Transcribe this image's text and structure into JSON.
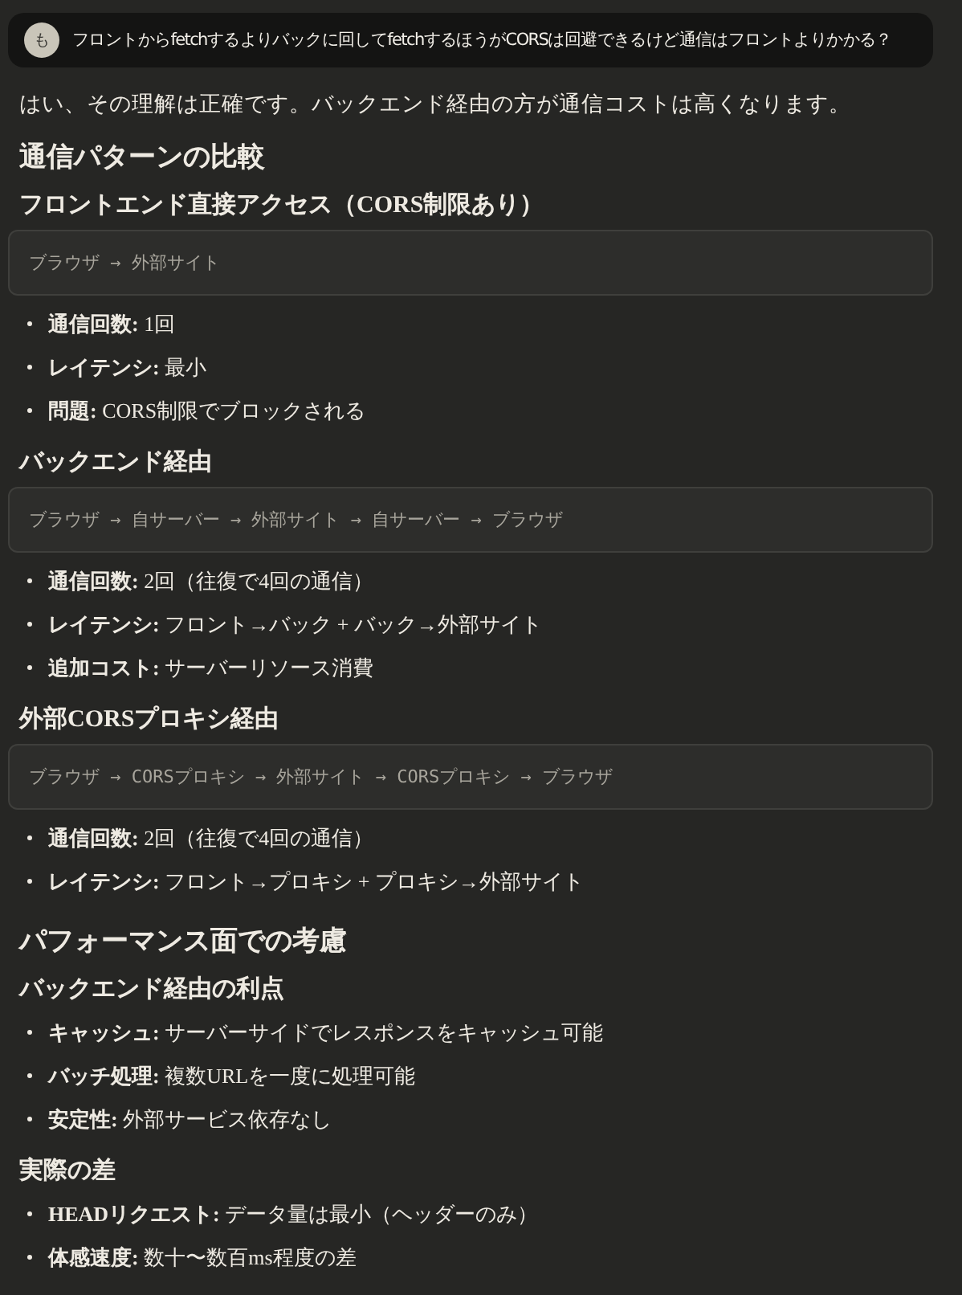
{
  "user_message": {
    "avatar": "も",
    "text": "フロントからfetchするよりバックに回してfetchするほうがCORSは回避できるけど通信はフロントよりかかる？"
  },
  "blocks": [
    {
      "kind": "paragraph",
      "text": "はい、その理解は正確です。バックエンド経由の方が通信コストは高くなります。"
    },
    {
      "kind": "h2",
      "text": "通信パターンの比較"
    },
    {
      "kind": "h3",
      "text": "フロントエンド直接アクセス（CORS制限あり）"
    },
    {
      "kind": "code",
      "text": "ブラウザ → 外部サイト"
    },
    {
      "kind": "list",
      "items": [
        "**通信回数:** 1回",
        "**レイテンシ:** 最小",
        "**問題:** CORS制限でブロックされる"
      ]
    },
    {
      "kind": "h3",
      "text": "バックエンド経由"
    },
    {
      "kind": "code",
      "text": "ブラウザ → 自サーバー → 外部サイト → 自サーバー → ブラウザ"
    },
    {
      "kind": "list",
      "items": [
        "**通信回数:** 2回（往復で4回の通信）",
        "**レイテンシ:** フロント→バック + バック→外部サイト",
        "**追加コスト:** サーバーリソース消費"
      ]
    },
    {
      "kind": "h3",
      "text": "外部CORSプロキシ経由"
    },
    {
      "kind": "code",
      "text": "ブラウザ → CORSプロキシ → 外部サイト → CORSプロキシ → ブラウザ"
    },
    {
      "kind": "list",
      "items": [
        "**通信回数:** 2回（往復で4回の通信）",
        "**レイテンシ:** フロント→プロキシ + プロキシ→外部サイト"
      ]
    },
    {
      "kind": "h2",
      "text": "パフォーマンス面での考慮"
    },
    {
      "kind": "h3",
      "text": "バックエンド経由の利点"
    },
    {
      "kind": "list",
      "items": [
        "**キャッシュ:** サーバーサイドでレスポンスをキャッシュ可能",
        "**バッチ処理:** 複数URLを一度に処理可能",
        "**安定性:** 外部サービス依存なし"
      ]
    },
    {
      "kind": "h3",
      "text": "実際の差"
    },
    {
      "kind": "list",
      "items": [
        "**HEADリクエスト:** データ量は最小（ヘッダーのみ）",
        "**体感速度:** 数十〜数百ms程度の差"
      ]
    }
  ]
}
